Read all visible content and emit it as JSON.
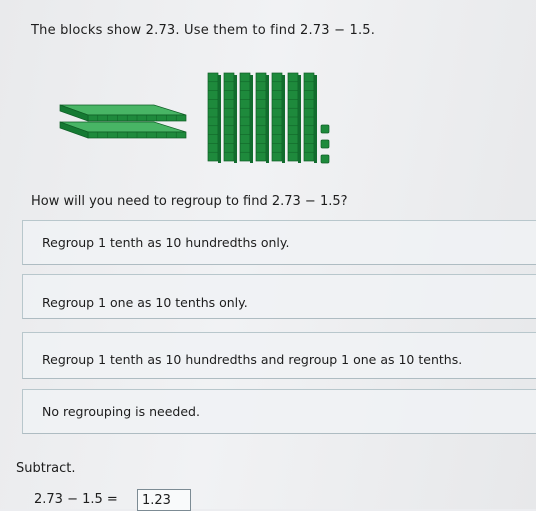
{
  "problem": {
    "prompt": "The blocks show 2.73. Use them to find 2.73 − 1.5.",
    "question": "How will you need to regroup to find 2.73 − 1.5?",
    "choices": [
      "Regroup 1 tenth as 10 hundredths only.",
      "Regroup 1 one as 10 tenths only.",
      "Regroup 1 tenth as 10 hundredths and regroup 1 one as 10 tenths.",
      "No regrouping is needed."
    ]
  },
  "blocks": {
    "ones_count": 2,
    "tenths_count": 7,
    "hundredths_count": 3,
    "color": "#1e8a3c"
  },
  "subtract": {
    "label": "Subtract.",
    "equation": "2.73 − 1.5 =",
    "answer_value": "1.23"
  }
}
